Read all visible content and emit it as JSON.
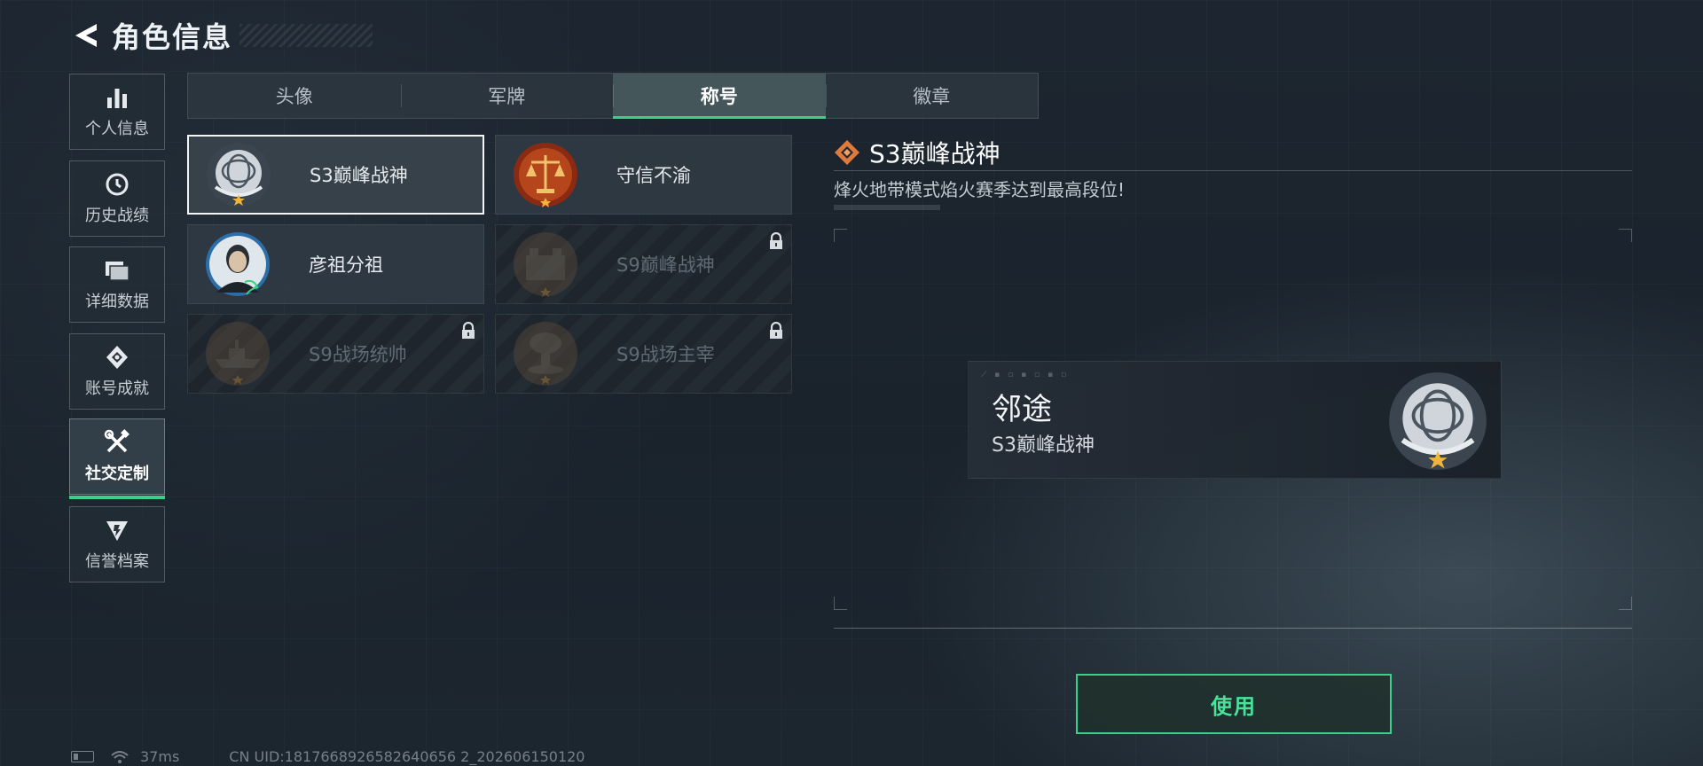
{
  "header": {
    "title": "角色信息"
  },
  "sidebar": {
    "items": [
      {
        "label": "个人信息",
        "icon": "bar-chart-icon"
      },
      {
        "label": "历史战绩",
        "icon": "clock-icon"
      },
      {
        "label": "详细数据",
        "icon": "folder-icon"
      },
      {
        "label": "账号成就",
        "icon": "achievement-icon"
      },
      {
        "label": "社交定制",
        "icon": "tools-icon",
        "active": true
      },
      {
        "label": "信誉档案",
        "icon": "shield-badge-icon"
      }
    ]
  },
  "tabs": [
    {
      "label": "头像"
    },
    {
      "label": "军牌"
    },
    {
      "label": "称号",
      "active": true
    },
    {
      "label": "徽章"
    }
  ],
  "titles": [
    {
      "name": "S3巅峰战神",
      "selected": true,
      "locked": false,
      "badge": "globe-laurel-badge-icon"
    },
    {
      "name": "守信不渝",
      "selected": false,
      "locked": false,
      "badge": "scales-badge-icon"
    },
    {
      "name": "彦祖分祖",
      "selected": false,
      "locked": false,
      "badge": "portrait-badge-icon"
    },
    {
      "name": "S9巅峰战神",
      "selected": false,
      "locked": true,
      "badge": "fortress-badge-icon"
    },
    {
      "name": "S9战场统帅",
      "selected": false,
      "locked": true,
      "badge": "warship-badge-icon"
    },
    {
      "name": "S9战场主宰",
      "selected": false,
      "locked": true,
      "badge": "mushroom-cloud-badge-icon"
    }
  ],
  "detail": {
    "title": "S3巅峰战神",
    "description": "烽火地带模式焰火赛季达到最高段位!"
  },
  "preview": {
    "player_name": "邻途",
    "title": "S3巅峰战神"
  },
  "actions": {
    "use_label": "使用"
  },
  "status": {
    "latency": "37ms",
    "uid": "CN UID:1817668926582640656 2_202606150120"
  },
  "colors": {
    "accent": "#3ad08c",
    "accent_text": "#48e39a",
    "rank_orange": "#e07a3a"
  }
}
